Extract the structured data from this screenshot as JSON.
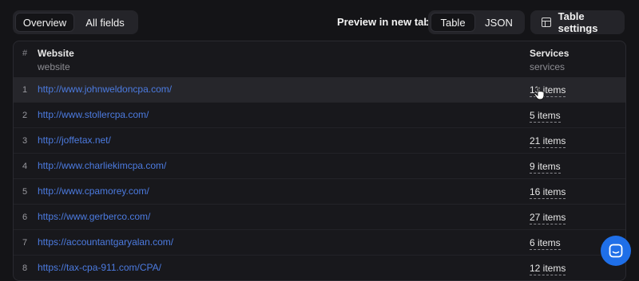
{
  "toolbar": {
    "view_tabs": [
      {
        "label": "Overview",
        "active": true
      },
      {
        "label": "All fields",
        "active": false
      }
    ],
    "preview_label": "Preview in new tab",
    "format_tabs": [
      {
        "label": "Table",
        "active": true
      },
      {
        "label": "JSON",
        "active": false
      }
    ],
    "settings_label": "Table settings"
  },
  "table": {
    "columns": [
      {
        "index_label": "#"
      },
      {
        "title": "Website",
        "field": "website"
      },
      {
        "title": "Services",
        "field": "services"
      }
    ],
    "rows": [
      {
        "num": "1",
        "website": "http://www.johnweldoncpa.com/",
        "services": "13 items"
      },
      {
        "num": "2",
        "website": "http://www.stollercpa.com/",
        "services": "5 items"
      },
      {
        "num": "3",
        "website": "http://joffetax.net/",
        "services": "21 items"
      },
      {
        "num": "4",
        "website": "http://www.charliekimcpa.com/",
        "services": "9 items"
      },
      {
        "num": "5",
        "website": "http://www.cpamorey.com/",
        "services": "16 items"
      },
      {
        "num": "6",
        "website": "https://www.gerberco.com/",
        "services": "27 items"
      },
      {
        "num": "7",
        "website": "https://accountantgaryalan.com/",
        "services": "6 items"
      },
      {
        "num": "8",
        "website": "https://tax-cpa-911.com/CPA/",
        "services": "12 items"
      }
    ],
    "hovered_row": 1
  },
  "colors": {
    "link": "#4c7be0",
    "chat_button": "#1f6fe8"
  },
  "icons": {
    "settings": "table-settings-icon",
    "chat": "chat-icon",
    "cursor": "hand-pointer-icon"
  }
}
